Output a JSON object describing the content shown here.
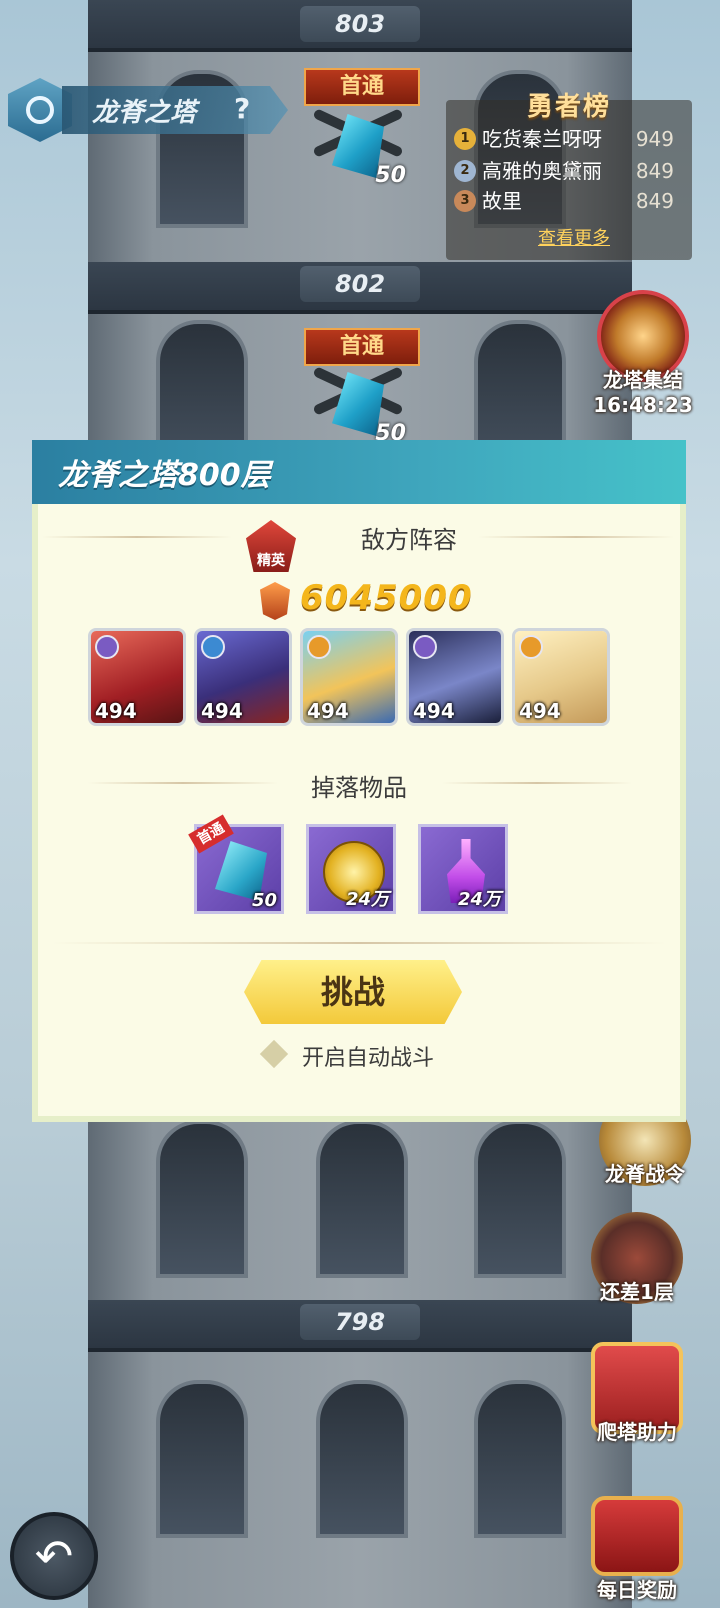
{
  "header": {
    "title": "龙脊之塔",
    "help": "?"
  },
  "tower": {
    "floors": [
      {
        "number": "803"
      },
      {
        "number": "802"
      },
      {
        "number": "798"
      }
    ],
    "first_clear_tag": "首通",
    "reward_count": "50"
  },
  "leaderboard": {
    "title": "勇者榜",
    "rows": [
      {
        "rank": "1",
        "name": "吃货秦兰呀呀",
        "score": "949"
      },
      {
        "rank": "2",
        "name": "高雅的奥黛丽",
        "score": "849"
      },
      {
        "rank": "3",
        "name": "故里",
        "score": "849"
      }
    ],
    "more_label": "查看更多"
  },
  "side_buttons": {
    "rally": {
      "label": "龙塔集结",
      "timer": "16:48:23"
    },
    "pass": {
      "label": "龙脊战令"
    },
    "remaining": {
      "label": "还差1层"
    },
    "climb_help": {
      "label": "爬塔助力"
    },
    "daily": {
      "label": "每日奖励"
    }
  },
  "dialog": {
    "title": "龙脊之塔800层",
    "enemy_section_title": "敌方阵容",
    "elite_label": "精英",
    "power_value": "6045000",
    "heroes": [
      {
        "level": "494"
      },
      {
        "level": "494"
      },
      {
        "level": "494"
      },
      {
        "level": "494"
      },
      {
        "level": "494"
      }
    ],
    "drops_section_title": "掉落物品",
    "items": [
      {
        "qty": "50",
        "tag": "首通"
      },
      {
        "qty": "24万"
      },
      {
        "qty": "24万"
      }
    ],
    "challenge_label": "挑战",
    "auto_battle_label": "开启自动战斗"
  },
  "colors": {
    "accent_teal": "#3fa6bd",
    "power_gold": "#f4b61c",
    "button_yellow": "#f3c93a"
  }
}
